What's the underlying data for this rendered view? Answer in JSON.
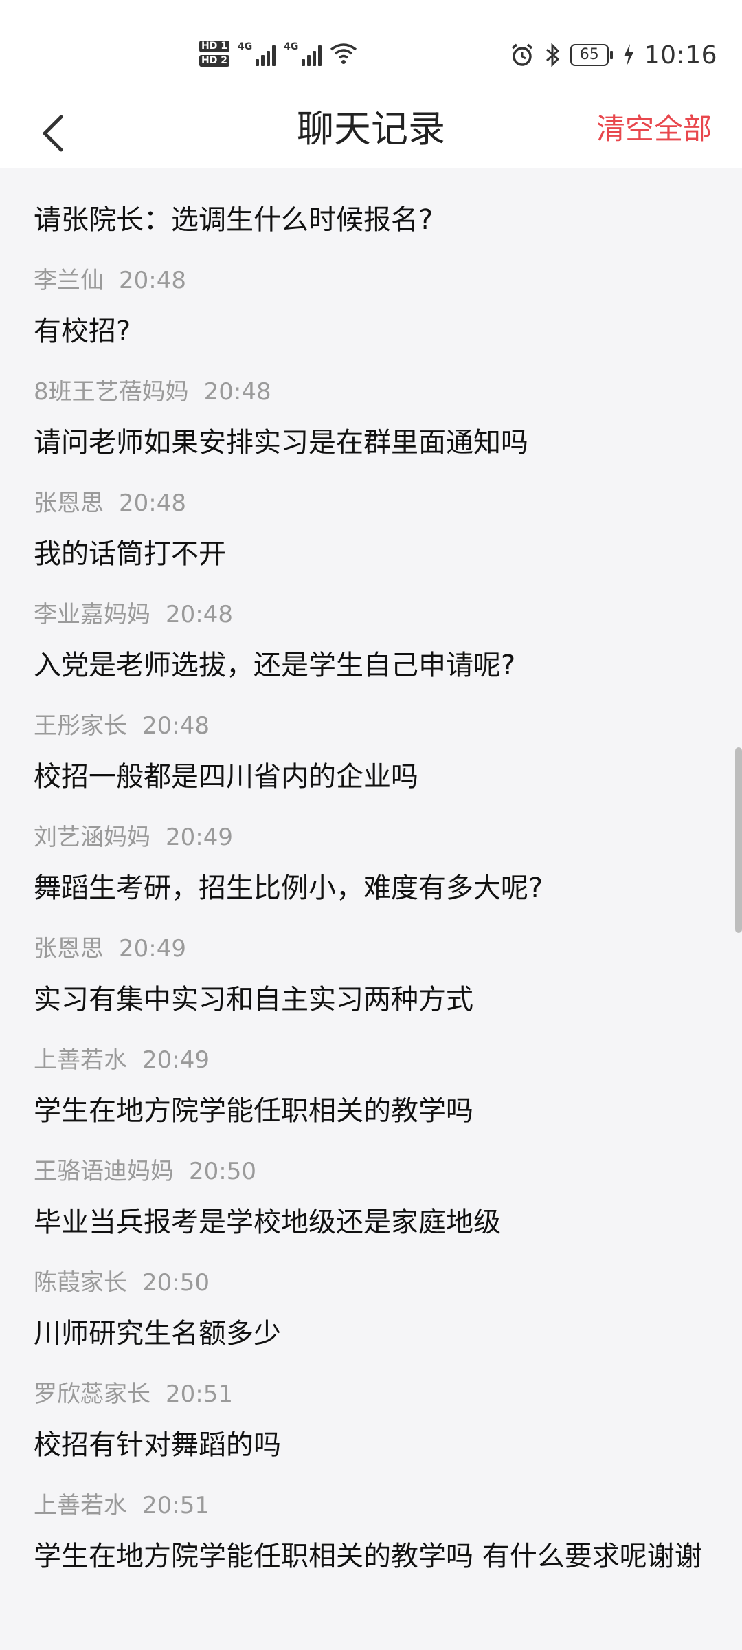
{
  "status_bar": {
    "hd1": "HD 1",
    "hd2": "HD 2",
    "net1": "4G",
    "net2": "4G",
    "battery": "65",
    "time": "10:16"
  },
  "header": {
    "title": "聊天记录",
    "clear_label": "清空全部"
  },
  "first_message": "请张院长：选调生什么时候报名?",
  "messages": [
    {
      "sender": "李兰仙",
      "time": "20:48",
      "text": "有校招?"
    },
    {
      "sender": "8班王艺蓓妈妈",
      "time": "20:48",
      "text": "请问老师如果安排实习是在群里面通知吗"
    },
    {
      "sender": "张恩思",
      "time": "20:48",
      "text": "我的话筒打不开"
    },
    {
      "sender": "李业嘉妈妈",
      "time": "20:48",
      "text": "入党是老师选拔，还是学生自己申请呢?"
    },
    {
      "sender": "王彤家长",
      "time": "20:48",
      "text": "校招一般都是四川省内的企业吗"
    },
    {
      "sender": "刘艺涵妈妈",
      "time": "20:49",
      "text": "舞蹈生考研，招生比例小，难度有多大呢?"
    },
    {
      "sender": "张恩思",
      "time": "20:49",
      "text": "实习有集中实习和自主实习两种方式"
    },
    {
      "sender": "上善若水",
      "time": "20:49",
      "text": "学生在地方院学能任职相关的教学吗"
    },
    {
      "sender": "王骆语迪妈妈",
      "time": "20:50",
      "text": "毕业当兵报考是学校地级还是家庭地级"
    },
    {
      "sender": "陈葭家长",
      "time": "20:50",
      "text": "川师研究生名额多少"
    },
    {
      "sender": "罗欣蕊家长",
      "time": "20:51",
      "text": "校招有针对舞蹈的吗"
    },
    {
      "sender": "上善若水",
      "time": "20:51",
      "text": "学生在地方院学能任职相关的教学吗  有什么要求呢谢谢"
    }
  ],
  "colors": {
    "accent": "#e8474d",
    "meta_text": "#9a9a9a",
    "background": "#f5f5f7"
  }
}
